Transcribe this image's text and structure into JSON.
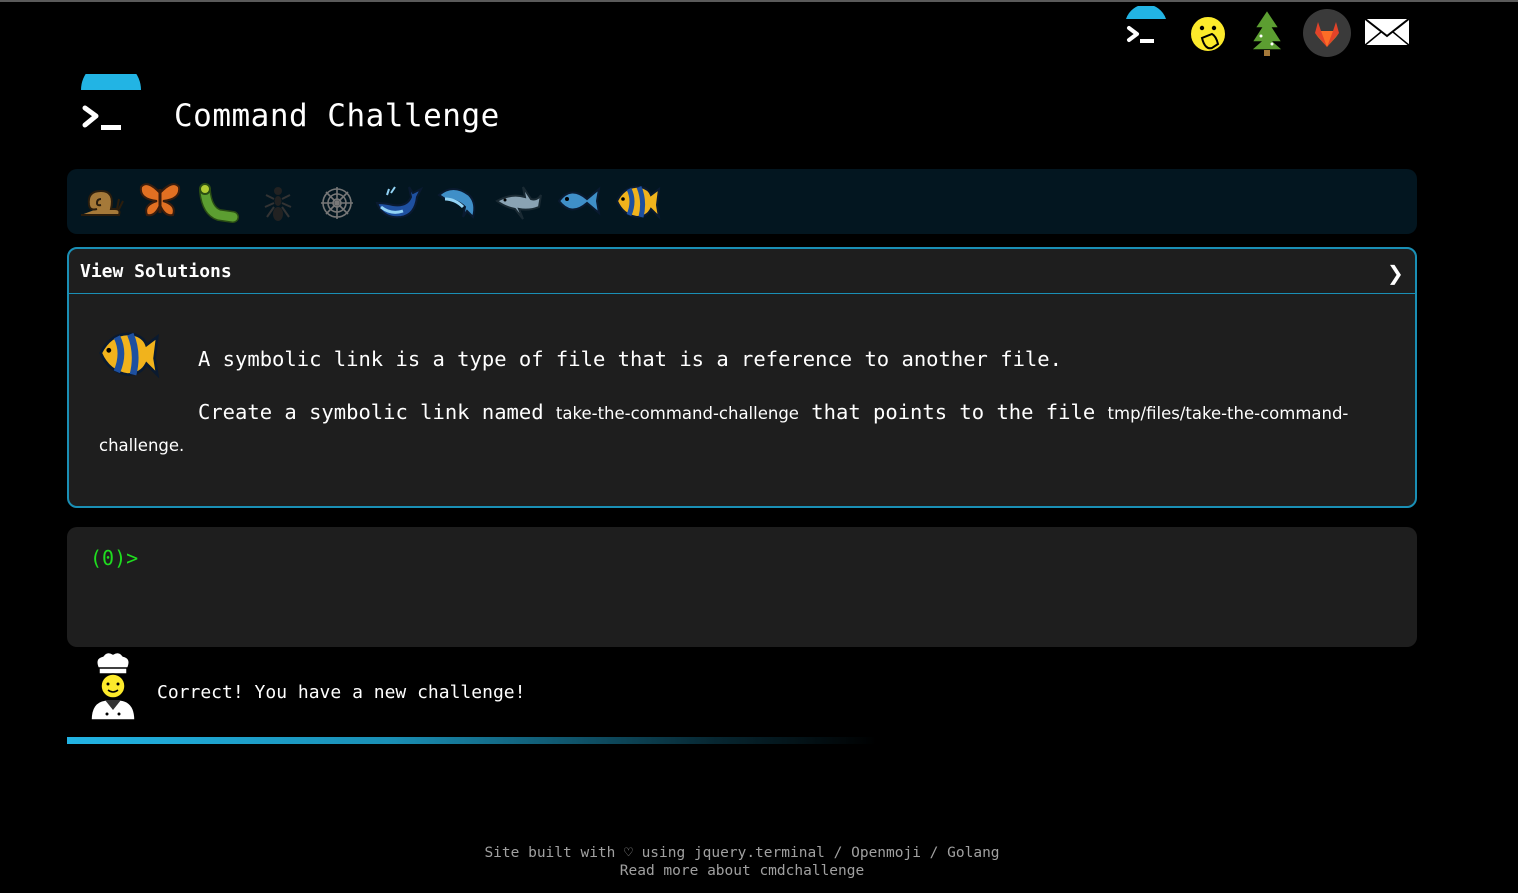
{
  "page": {
    "title": "Command Challenge"
  },
  "nav": {
    "items": [
      "terminal-logo",
      "face-with-hand-icon",
      "tree-icon",
      "gitlab-icon",
      "mail-icon"
    ]
  },
  "levels": {
    "icons": [
      "snail-icon",
      "butterfly-icon",
      "caterpillar-icon",
      "ant-icon",
      "spider-web-icon",
      "whale-icon",
      "dolphin-icon",
      "shark-icon",
      "fish-icon",
      "tropical-fish-icon"
    ],
    "current": "tropical-fish-icon"
  },
  "card": {
    "header": "View Solutions",
    "chevron": "❯",
    "description": "A symbolic link is a type of file that is a reference to another file.",
    "task_prefix": "Create a symbolic link named ",
    "task_code1": "take-the-command-challenge",
    "task_middle": " that points to the file ",
    "task_code2": "tmp/files/take-the-command-challenge",
    "task_suffix": "."
  },
  "terminal": {
    "prompt": "(0)>"
  },
  "feedback": {
    "message": "Correct! You have a new challenge!",
    "progress": 1.0
  },
  "footer": {
    "line1_prefix": "Site built with ♡ using ",
    "link_jquery": "jquery.terminal",
    "sep1": " / ",
    "link_openmoji": "Openmoji",
    "sep2": " / ",
    "link_golang": "Golang",
    "line2": "Read more about cmdchallenge"
  },
  "colors": {
    "accent": "#1a8fb5",
    "prompt": "#1fdd1f",
    "level_bar": "#031620",
    "panel": "#1e1e1e"
  }
}
